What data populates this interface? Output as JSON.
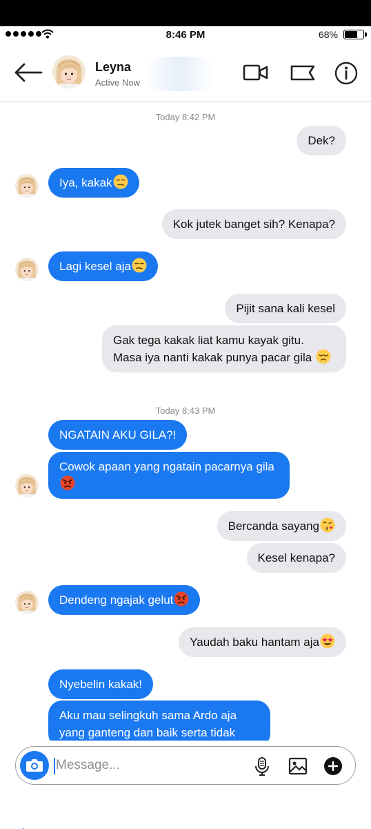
{
  "status_bar": {
    "time": "8:46 PM",
    "battery": "68%",
    "battery_level": 0.68
  },
  "header": {
    "contact_name": "Leyna",
    "contact_status": "Active Now",
    "icons": [
      "back-arrow-icon",
      "video-call-icon",
      "flag-icon",
      "info-icon"
    ]
  },
  "timestamps": [
    "Today 8:42 PM",
    "Today 8:43 PM"
  ],
  "messages": [
    {
      "from": "me",
      "text": "Dek?"
    },
    {
      "from": "them",
      "text": "Iya, kakak",
      "emoji": "unamused"
    },
    {
      "from": "me",
      "text": "Kok jutek banget sih? Kenapa?"
    },
    {
      "from": "them",
      "text": "Lagi kesel aja",
      "emoji": "unamused"
    },
    {
      "from": "me",
      "text": "Pijit sana kali kesel"
    },
    {
      "from": "me",
      "text": "Gak tega kakak liat kamu kayak gitu. Masa iya nanti kakak punya pacar gila",
      "emoji": "pensive"
    },
    {
      "from": "them",
      "text": "NGATAIN AKU GILA?!"
    },
    {
      "from": "them",
      "text": "Cowok apaan yang ngatain pacarnya gila",
      "emoji": "angry"
    },
    {
      "from": "me",
      "text": "Bercanda sayang",
      "emoji": "kissing-heart"
    },
    {
      "from": "me",
      "text": "Kesel kenapa?"
    },
    {
      "from": "them",
      "text": "Dendeng ngajak gelut",
      "emoji": "angry"
    },
    {
      "from": "me",
      "text": "Yaudah baku hantam aja",
      "emoji": "star-struck"
    },
    {
      "from": "them",
      "text": "Nyebelin kakak!"
    },
    {
      "from": "them",
      "text": "Aku mau selingkuh sama Ardo aja yang ganteng dan baik serta tidak"
    }
  ],
  "composer": {
    "placeholder": "Message...",
    "icons": [
      "camera-icon",
      "microphone-icon",
      "image-icon",
      "plus-icon"
    ]
  },
  "colors": {
    "incoming_bubble": "#1a78f0",
    "outgoing_bubble": "#e7e7ec",
    "accent": "#1a78f0"
  }
}
